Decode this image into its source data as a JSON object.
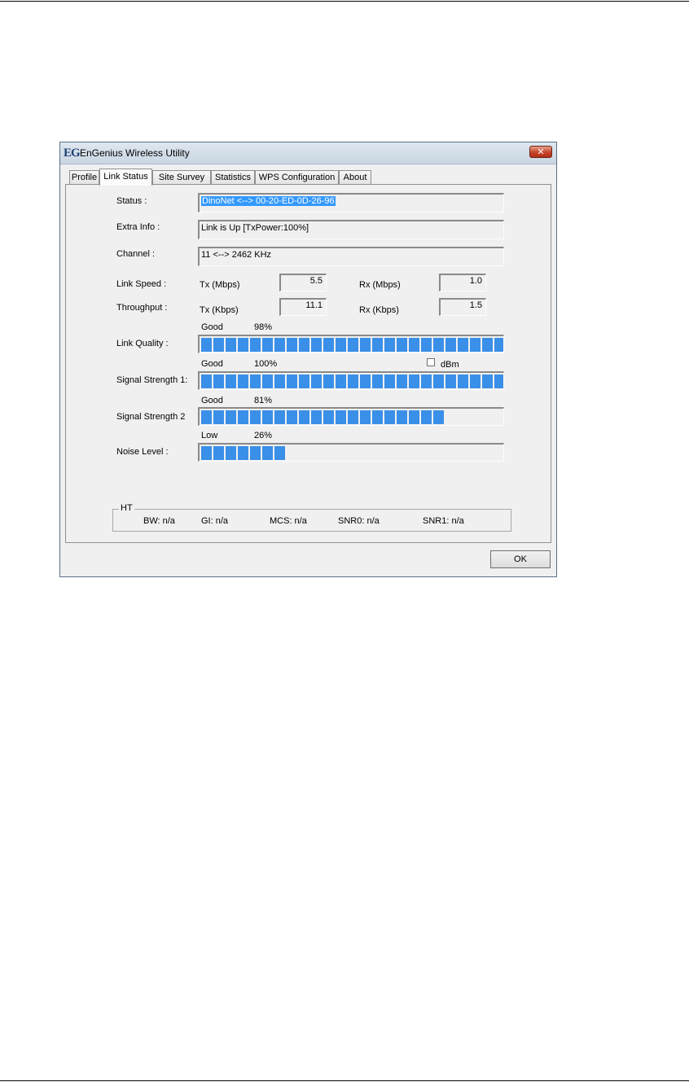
{
  "window": {
    "logo": "EG",
    "title": "EnGenius Wireless Utility",
    "close_glyph": "✕"
  },
  "tabs": [
    {
      "label": "Profile",
      "active": false
    },
    {
      "label": "Link Status",
      "active": true
    },
    {
      "label": "Site Survey",
      "active": false
    },
    {
      "label": "Statistics",
      "active": false
    },
    {
      "label": "WPS Configuration",
      "active": false
    },
    {
      "label": "About",
      "active": false
    }
  ],
  "status": {
    "label": "Status :",
    "value": "DinoNet <--> 00-20-ED-0D-26-96"
  },
  "extra_info": {
    "label": "Extra Info :",
    "value": "Link is Up [TxPower:100%]"
  },
  "channel": {
    "label": "Channel :",
    "value": "11 <--> 2462 KHz"
  },
  "link_speed": {
    "label": "Link Speed :",
    "tx_label": "Tx (Mbps)",
    "tx_value": "5.5",
    "rx_label": "Rx (Mbps)",
    "rx_value": "1.0"
  },
  "throughput": {
    "label": "Throughput :",
    "tx_label": "Tx (Kbps)",
    "tx_value": "11.1",
    "rx_label": "Rx (Kbps)",
    "rx_value": "1.5"
  },
  "link_quality": {
    "label": "Link Quality :",
    "quality": "Good",
    "percent_text": "98%",
    "level": 0.98
  },
  "signal_strength_1": {
    "label": "Signal Strength 1:",
    "quality": "Good",
    "percent_text": "100%",
    "level": 1.0
  },
  "dbm": {
    "label": "dBm",
    "checked": false
  },
  "signal_strength_2": {
    "label": "Signal Strength 2",
    "quality": "Good",
    "percent_text": "81%",
    "level": 0.81
  },
  "noise_level": {
    "label": "Noise Level :",
    "quality": "Low",
    "percent_text": "26%",
    "level": 0.26
  },
  "ht": {
    "legend": "HT",
    "bw": "BW: n/a",
    "gi": "GI: n/a",
    "mcs": "MCS: n/a",
    "snr0": "SNR0: n/a",
    "snr1": "SNR1: n/a"
  },
  "ok_label": "OK",
  "colors": {
    "bar_fill": "#3a8fe8",
    "selection": "#3399ff"
  }
}
